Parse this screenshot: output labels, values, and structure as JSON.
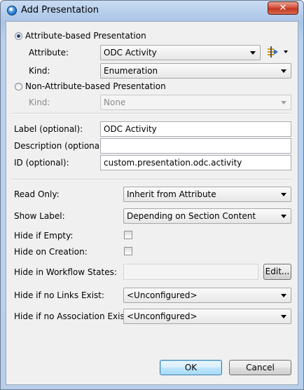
{
  "window": {
    "title": "Add Presentation",
    "close_label": "✕"
  },
  "presentation_type": {
    "attribute_based_label": "Attribute-based Presentation",
    "attribute_label": "Attribute:",
    "attribute_value": "ODC Activity",
    "kind_label": "Kind:",
    "kind_value": "Enumeration",
    "non_attribute_label": "Non-Attribute-based Presentation",
    "non_kind_label": "Kind:",
    "non_kind_value": "None"
  },
  "fields": {
    "label_label": "Label (optional):",
    "label_value": "ODC Activity",
    "description_label": "Description (optional):",
    "description_value": "",
    "id_label": "ID (optional):",
    "id_value": "custom.presentation.odc.activity"
  },
  "options": {
    "read_only_label": "Read Only:",
    "read_only_value": "Inherit from Attribute",
    "show_label_label": "Show Label:",
    "show_label_value": "Depending on Section Content",
    "hide_empty_label": "Hide if Empty:",
    "hide_empty_checked": false,
    "hide_creation_label": "Hide on Creation:",
    "hide_creation_checked": false,
    "hide_workflow_label": "Hide in Workflow States:",
    "hide_workflow_value": "",
    "edit_label": "Edit...",
    "hide_no_links_label": "Hide if no Links Exist:",
    "hide_no_links_value": "<Unconfigured>",
    "hide_no_assoc_label": "Hide if no Association Exists:",
    "hide_no_assoc_value": "<Unconfigured>"
  },
  "buttons": {
    "ok_label": "OK",
    "cancel_label": "Cancel"
  }
}
